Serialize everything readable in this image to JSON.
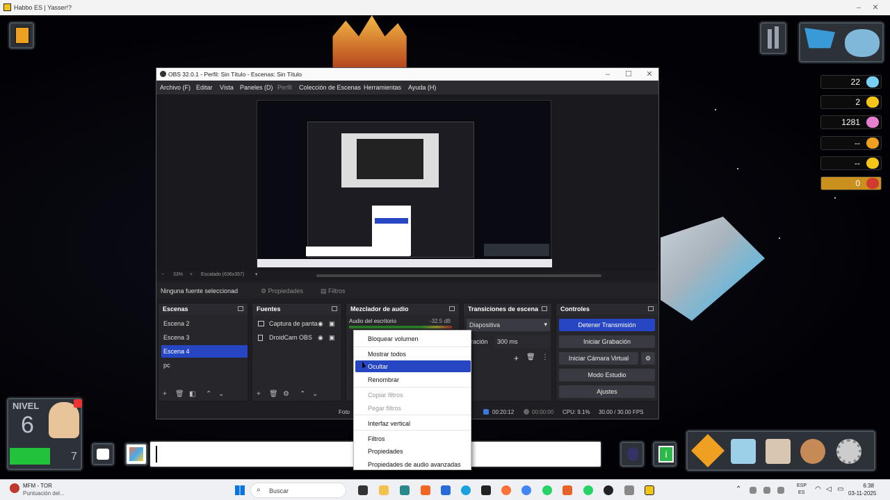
{
  "window": {
    "title": "Habbo ES | Yasser!?"
  },
  "hud": {
    "currencies": [
      {
        "value": "22",
        "color": "#7ad0f5"
      },
      {
        "value": "2",
        "color": "#f5c518"
      },
      {
        "value": "1281",
        "color": "#e67fd0"
      },
      {
        "value": "--",
        "color": "#f0a020"
      },
      {
        "value": "--",
        "color": "#f5c518"
      },
      {
        "value": "0",
        "color": "#d33a2e"
      }
    ],
    "level": {
      "label": "NIVEL",
      "value": "6",
      "progress": "7"
    }
  },
  "obs": {
    "title": "OBS 32.0.1 - Perfil: Sin Título - Escenas: Sin Título",
    "menu": [
      "Archivo (F)",
      "Editar",
      "Vista",
      "Paneles (D)",
      "Perfil",
      "Colección de Escenas",
      "Herramientas",
      "Ayuda (H)"
    ],
    "zoom": "33%",
    "scaled": "Escalado (636x357)",
    "source_bar": {
      "none": "Ninguna fuente seleccionad",
      "properties": "Propiedades",
      "filters": "Filtros"
    },
    "scenes": {
      "title": "Escenas",
      "items": [
        "Escena 2",
        "Escena 3",
        "Escena 4",
        "pc"
      ]
    },
    "sources": {
      "title": "Fuentes",
      "items": [
        "Captura de panta",
        "DroidCam OBS"
      ]
    },
    "mixer": {
      "title": "Mezclador de audio",
      "channel": "Audio del escritorio",
      "db": "-32.5 dB"
    },
    "transitions": {
      "title": "Transiciones de escena",
      "selected": "Diapositiva",
      "duration_label": "ración",
      "duration": "300 ms"
    },
    "controls": {
      "title": "Controles",
      "buttons": [
        "Detener Transmisión",
        "Iniciar Grabación",
        "Iniciar Cámara Virtual",
        "Modo Estudio",
        "Ajustes"
      ]
    },
    "status": {
      "left": "Foto",
      "live": "00:20:12",
      "rec": "00:00:00",
      "cpu": "CPU: 9.1%",
      "fps": "30.00 / 30.00 FPS"
    }
  },
  "context_menu": [
    "Bloquear volumen",
    "Mostrar todos",
    "Ocultar",
    "Renombrar",
    "Copiar filtros",
    "Pegar filtros",
    "Interfaz vertical",
    "Filtros",
    "Propiedades",
    "Propiedades de audio avanzadas"
  ],
  "taskbar": {
    "notif_title": "MFM - TOR",
    "notif_sub": "Puntuación del...",
    "search": "Buscar",
    "lang": "ESP",
    "lang2": "ES",
    "time": "6:38",
    "date": "03-11-2025"
  }
}
